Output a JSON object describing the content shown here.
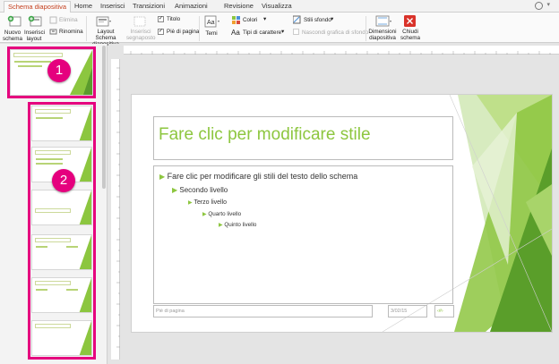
{
  "tabs": [
    "Schema diapositiva",
    "Home",
    "Inserisci",
    "Transizioni",
    "Animazioni",
    "Revisione",
    "Visualizza"
  ],
  "ribbon": {
    "new_master": "Nuovo schema",
    "insert_layout": "Inserisci layout",
    "delete": "Elimina",
    "rename": "Rinomina",
    "master_layout": "Layout Schema diapositiva",
    "insert_placeholder": "Inserisci segnaposto",
    "title_check": "Titolo",
    "footer_check": "Piè di pagina",
    "themes": "Temi",
    "colors": "Colori",
    "fonts": "Tipi di carattere",
    "bg_styles": "Stili sfondo",
    "hide_bg": "Nascondi grafica di sfondo",
    "slide_size": "Dimensioni diapositiva",
    "close_master": "Chiudi schema"
  },
  "badges": [
    "1",
    "2"
  ],
  "slide": {
    "title": "Fare clic per modificare stile",
    "level1": "Fare clic per modificare gli stili del testo dello schema",
    "level2": "Secondo livello",
    "level3": "Terzo livello",
    "level4": "Quarto livello",
    "level5": "Quinto livello",
    "footer": "Piè di pagina",
    "date": "3/02/15",
    "number": "‹#›"
  },
  "colors": {
    "accent": "#8dc63f",
    "highlight": "#e5007e",
    "active_tab": "#c43e1c"
  }
}
